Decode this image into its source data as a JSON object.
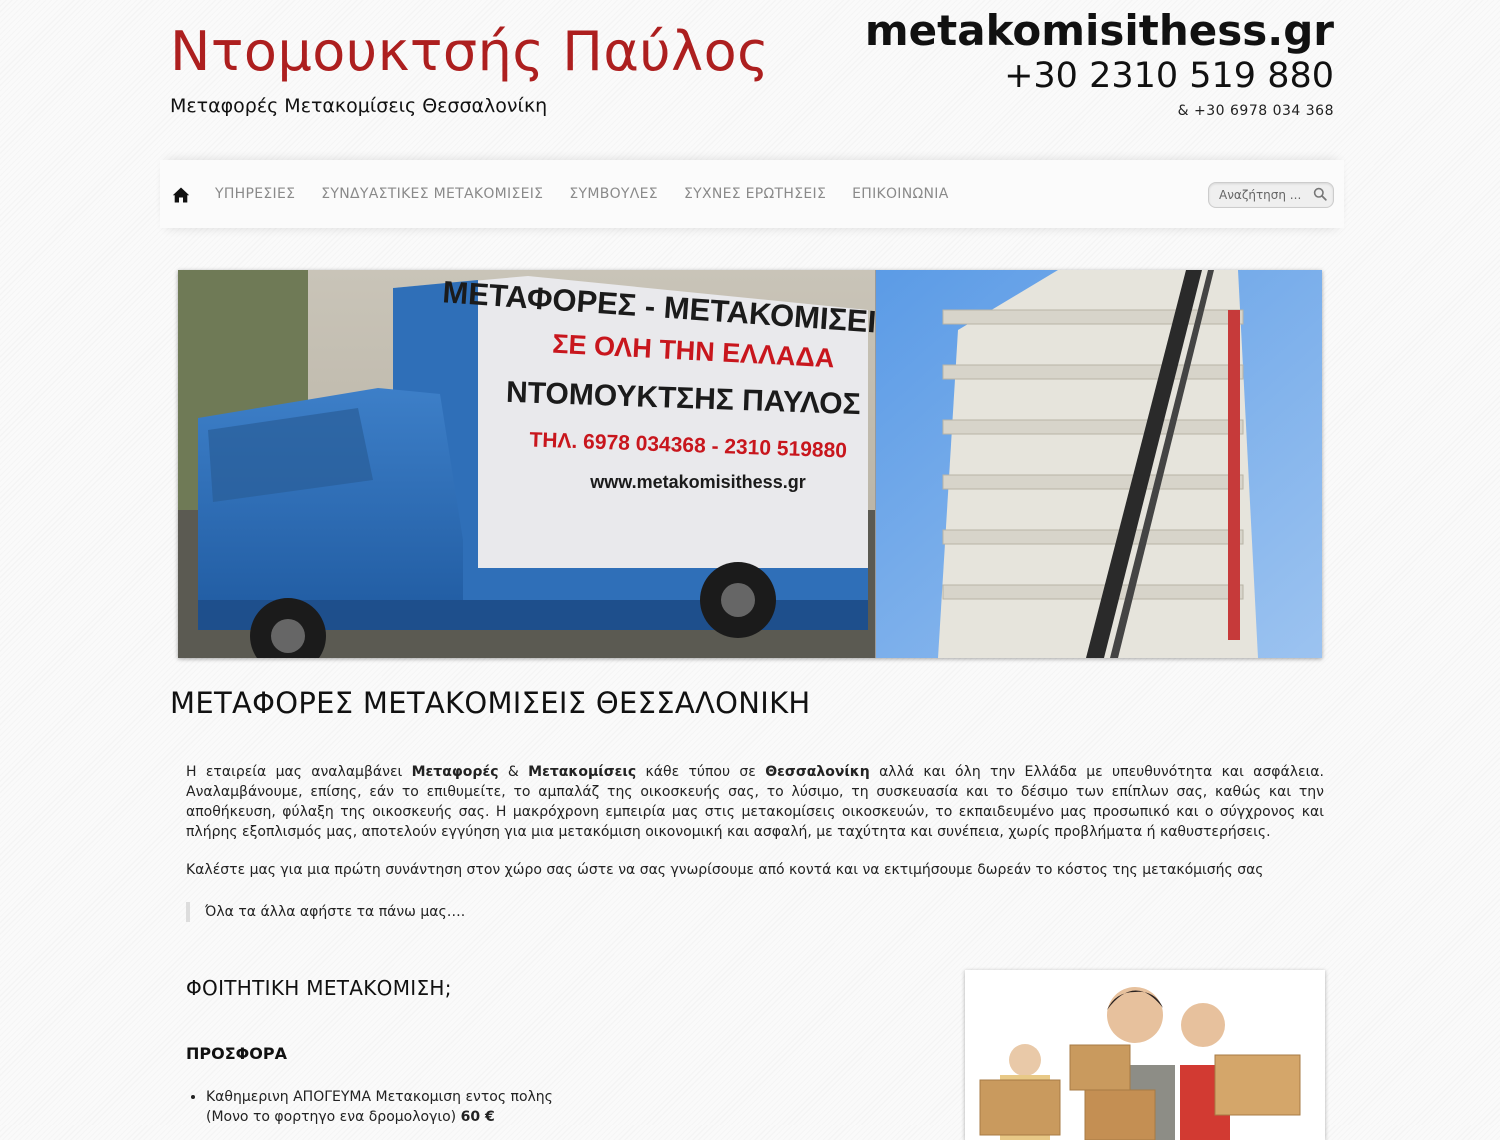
{
  "header": {
    "title": "Ντομουκτσής Παύλος",
    "subtitle": "Μεταφορές Μετακομίσεις Θεσσαλονίκη",
    "domain": "metakomisithess.gr",
    "phone_main": "+30 2310 519 880",
    "phone_secondary": "& +30 6978 034 368"
  },
  "nav": {
    "home_icon": "home-icon",
    "items": [
      "ΥΠΗΡΕΣΙΕΣ",
      "ΣΥΝΔΥΑΣΤΙΚΕΣ ΜΕΤΑΚΟΜΙΣΕΙΣ",
      "ΣΥΜΒΟΥΛΕΣ",
      "ΣΥΧΝΕΣ ΕΡΩΤΗΣΕΙΣ",
      "ΕΠΙΚΟΙΝΩΝΙΑ"
    ],
    "search_placeholder": "Αναζήτηση ..."
  },
  "hero": {
    "truck_sign": {
      "line1": "ΜΕΤΑΦΟΡΕΣ - ΜΕΤΑΚΟΜΙΣΕΙΣ",
      "line2": "ΣΕ ΟΛΗ ΤΗΝ ΕΛΛΑΔΑ",
      "line3": "ΝΤΟΜΟΥΚΤΣΗΣ ΠΑΥΛΟΣ",
      "line4": "ΤΗΛ. 6978 034368 - 2310 519880",
      "line5": "www.metakomisithess.gr"
    }
  },
  "main": {
    "title": "ΜΕΤΑΦΟΡΕΣ ΜΕΤΑΚΟΜΙΣΕΙΣ ΘΕΣΣΑΛΟΝΙΚΗ",
    "intro": {
      "part1": "Η εταιρεία μας αναλαμβάνει ",
      "bold1": "Μεταφορές",
      "part2": " & ",
      "bold2": "Μετακομίσεις",
      "part3": " κάθε τύπου σε ",
      "bold3": "Θεσσαλονίκη",
      "part4": " αλλά και όλη την Ελλάδα με υπευθυνότητα και ασφάλεια. Αναλαμβάνουμε, επίσης, εάν το επιθυμείτε, το αμπαλάζ της οικοσκευής σας, το λύσιμο, τη συσκευασία και το δέσιμο των επίπλων σας, καθώς και την αποθήκευση, φύλαξη της οικοσκευής σας. Η μακρόχρονη εμπειρία μας στις μετακομίσεις οικοσκευών, το εκπαιδευμένο μας προσωπικό και ο σύγχρονος και πλήρης εξοπλισμός μας, αποτελούν εγγύηση για μια μετακόμιση οικονομική και ασφαλή, με ταχύτητα και συνέπεια, χωρίς προβλήματα ή καθυστερήσεις."
    },
    "call_text": "Καλέστε μας για μια πρώτη συνάντηση στον χώρο σας ώστε να σας γνωρίσουμε από κοντά και να εκτιμήσουμε δωρεάν το κόστος της μετακόμισής σας",
    "quote": "Όλα τα άλλα αφήστε τα πάνω μας….",
    "student_heading": "ΦΟΙΤΗΤΙΚΗ ΜΕΤΑΚΟΜΙΣΗ;",
    "offer_heading": "ΠΡΟΣΦΟΡΑ",
    "offer_line1": "Καθημερινη ΑΠΟΓΕΥΜΑ Μετακομιση εντος πολης",
    "offer_line2": "(Μονο το φορτηγο ενα δρομολογιο) ",
    "offer_price": "60 €"
  },
  "colors": {
    "brand_red": "#ad1f1f",
    "truck_blue": "#2f6fb8",
    "sign_red": "#c8161d"
  }
}
